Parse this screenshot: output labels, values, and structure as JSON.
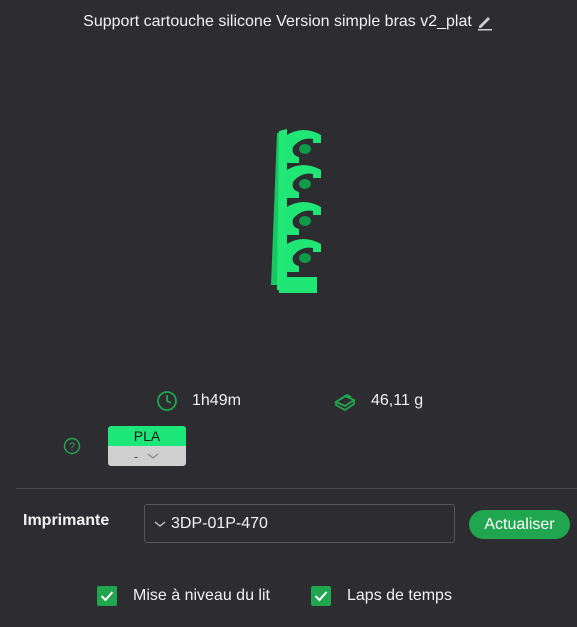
{
  "header": {
    "title": "Support cartouche silicone Version simple bras v2_plat",
    "edit_icon": "pencil-icon"
  },
  "stats": {
    "print_time": "1h49m",
    "weight": "46,11 g"
  },
  "filament": {
    "type": "PLA",
    "slot": "-",
    "color": "#1ee77a"
  },
  "printer": {
    "label": "Imprimante",
    "selected": "3DP-01P-470",
    "refresh_label": "Actualiser"
  },
  "options": {
    "bed_leveling_label": "Mise à niveau du lit",
    "bed_leveling_checked": true,
    "timelapse_label": "Laps de temps",
    "timelapse_checked": true
  },
  "colors": {
    "accent": "#1fa64f",
    "model": "#1ee77a",
    "background": "#2d2d31"
  }
}
